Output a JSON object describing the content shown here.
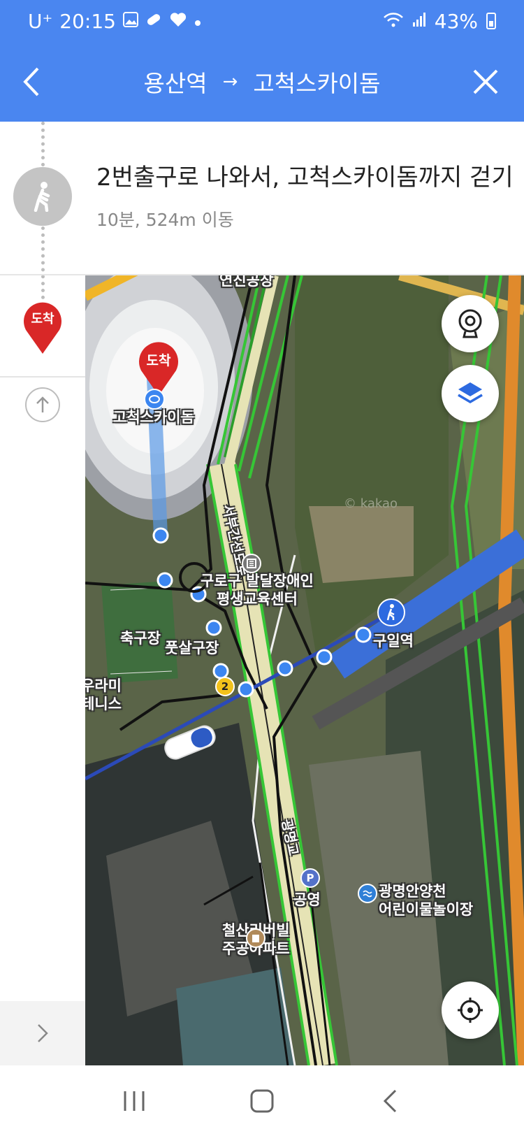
{
  "status_bar": {
    "carrier": "U⁺",
    "time": "20:15",
    "battery": "43%"
  },
  "header": {
    "origin": "용산역",
    "arrow": "→",
    "destination": "고척스카이돔"
  },
  "step": {
    "instruction": "2번출구로 나와서, 고척스카이돔까지 걷기",
    "detail": "10분, 524m 이동"
  },
  "rail": {
    "arrival_pin_label": "도착"
  },
  "map": {
    "dest_pin_label": "도착",
    "labels": {
      "dome": "고척스카이돔",
      "top_cut": "연진공장",
      "expressway": "서부간선도로",
      "center_line1": "구로구 발달장애인",
      "center_line2": "평생교육센터",
      "soccer": "축구장",
      "futsal": "풋살구장",
      "tennis_line1": "우라미",
      "tennis_line2": "테니스",
      "station": "구일역",
      "parking": "공영",
      "playground_line1": "광명안양천",
      "playground_line2": "어린이물놀이장",
      "apt_line1": "철산리버빌",
      "apt_line2": "주공아파트",
      "bridge": "광명교",
      "watermark": "© kakao"
    },
    "exit_number": "2"
  },
  "colors": {
    "brand_blue": "#4a86f0",
    "arrival_red": "#d92727",
    "route_blue": "#3b6fd8"
  }
}
